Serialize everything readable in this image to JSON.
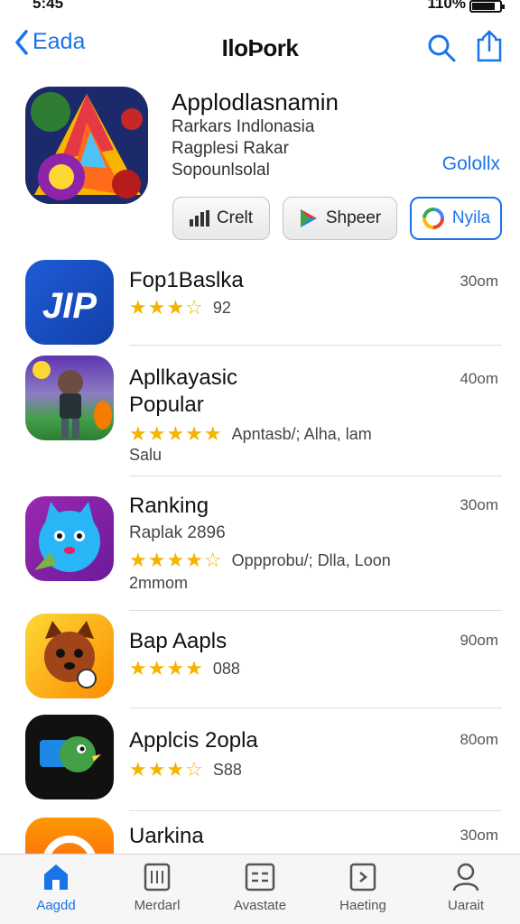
{
  "status": {
    "time": "5:45",
    "battery": "110%"
  },
  "nav": {
    "back_label": "Eada",
    "title": "IloÞork"
  },
  "featured": {
    "title": "Applodlasnamin",
    "line1": "Rarkars Indlonasia",
    "line2": "Ragplesi Rakar",
    "line3": "Sopounlsolal",
    "link": "Golollx",
    "buttons": [
      {
        "label": "Crelt",
        "icon": "bar-chart-icon"
      },
      {
        "label": "Shpeer",
        "icon": "play-store-icon"
      },
      {
        "label": "Nyila",
        "icon": "google-icon"
      }
    ]
  },
  "apps": [
    {
      "name": "Fop1Baslka",
      "rating": "3.5",
      "meta": "92",
      "time": "30om"
    },
    {
      "name": "Apllkayasic\nPopular",
      "rating": "5",
      "meta": "Apntasb/; Alha, lam",
      "sub": "Salu",
      "time": "40om"
    },
    {
      "name": "Ranking",
      "sub1": "Raplak 2896",
      "rating": "4.5",
      "meta": "Oppprobu/; Dlla, Loon",
      "sub2": "2mmom",
      "time": "30om"
    },
    {
      "name": "Bap Aapls",
      "rating": "4",
      "meta": "088",
      "time": "90om"
    },
    {
      "name": "Applcis 2opla",
      "rating": "3.5",
      "meta": "S88",
      "time": "80om"
    },
    {
      "name": "Uarkina",
      "time": "30om"
    }
  ],
  "stars_text": {
    "r35": "★★★☆",
    "r5": "★★★★★",
    "r45": "★★★★☆",
    "r4": "★★★★"
  },
  "tabs": [
    {
      "label": "Aagdd",
      "icon": "home-icon"
    },
    {
      "label": "Merdarl",
      "icon": "apps-icon"
    },
    {
      "label": "Avastate",
      "icon": "list-icon"
    },
    {
      "label": "Haeting",
      "icon": "arcade-icon"
    },
    {
      "label": "Uarait",
      "icon": "person-icon"
    }
  ],
  "colors": {
    "accent": "#1a73e8",
    "star": "#f4b400"
  }
}
